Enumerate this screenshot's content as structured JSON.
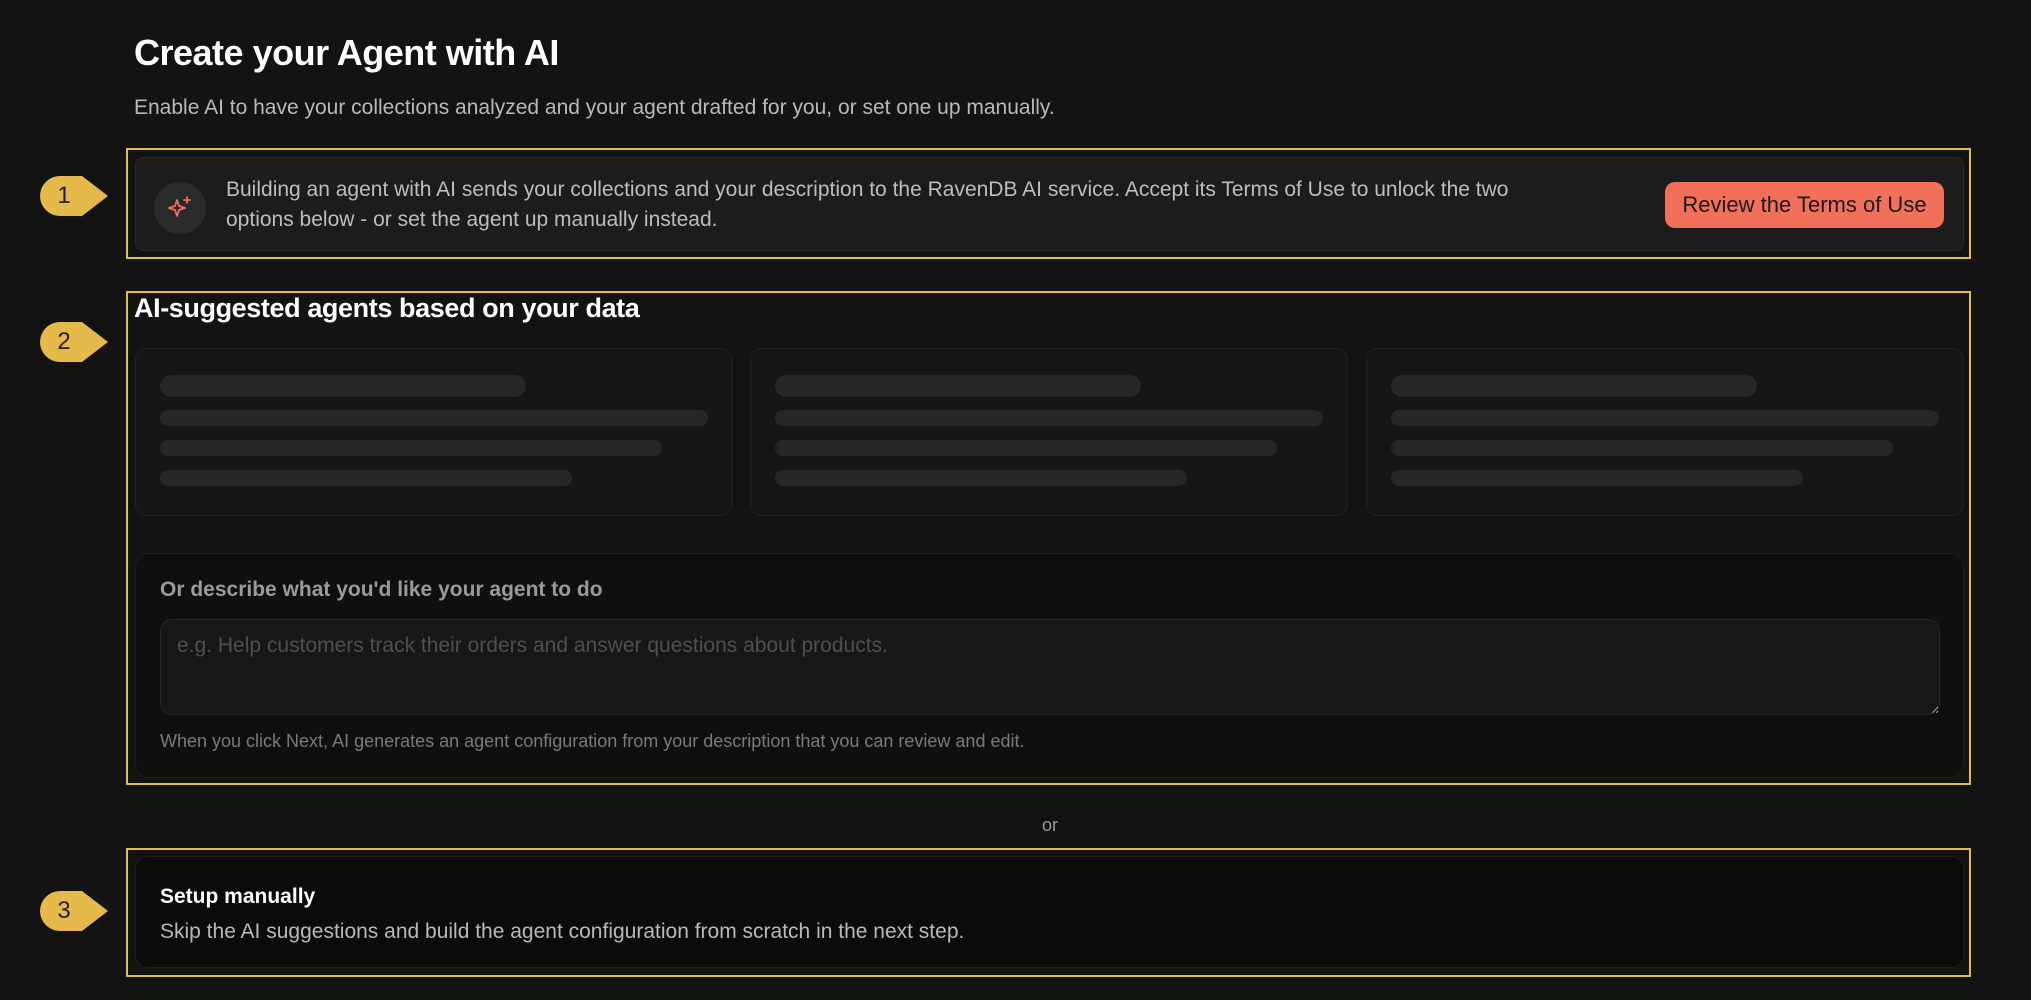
{
  "header": {
    "title": "Create your Agent with AI",
    "subtitle": "Enable AI to have your collections analyzed and your agent drafted for you, or set one up manually."
  },
  "markers": [
    "1",
    "2",
    "3"
  ],
  "terms_banner": {
    "icon": "sparkles-icon",
    "text": "Building an agent with AI sends your collections and your description to the RavenDB AI service. Accept its Terms of Use to unlock the two options below - or set the agent up manually instead.",
    "button_label": "Review the Terms of Use"
  },
  "suggestions": {
    "heading": "AI-suggested agents based on your data",
    "card_count": 3,
    "state": "loading"
  },
  "describe": {
    "label": "Or describe what you'd like your agent to do",
    "value": "",
    "placeholder": "e.g. Help customers track their orders and answer questions about products.",
    "note": "When you click Next, AI generates an agent configuration from your description that you can review and edit."
  },
  "divider_text": "or",
  "manual": {
    "title": "Setup manually",
    "description": "Skip the AI suggestions and build the agent configuration from scratch in the next step."
  },
  "colors": {
    "accent": "#f26f59",
    "highlight_outline": "#e6b94b",
    "background": "#131313"
  }
}
